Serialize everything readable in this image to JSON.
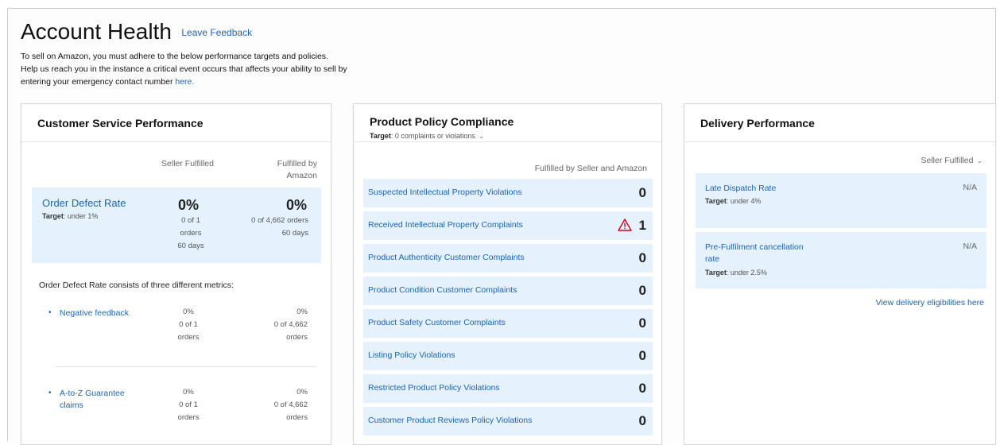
{
  "header": {
    "title": "Account Health",
    "feedback_link": "Leave Feedback",
    "intro_line1": "To sell on Amazon, you must adhere to the below performance targets and policies.",
    "intro_line2": "Help us reach you in the instance a critical event occurs that affects your ability to sell by",
    "intro_line3_prefix": "entering your emergency contact number ",
    "intro_link": "here."
  },
  "customer_service": {
    "title": "Customer Service Performance",
    "col_seller": "Seller Fulfilled",
    "col_fba_line1": "Fulfilled by",
    "col_fba_line2": "Amazon",
    "odr": {
      "name": "Order Defect Rate",
      "target_label": "Target",
      "target_value": ": under 1%",
      "seller_pct": "0%",
      "seller_line1": "0 of 1",
      "seller_line2": "orders",
      "seller_line3": "60 days",
      "fba_pct": "0%",
      "fba_line1": "0 of 4,662 orders",
      "fba_line2": "60 days"
    },
    "consists_text": "Order Defect Rate consists of three different metrics:",
    "metrics": [
      {
        "name_line1": "Negative feedback",
        "name_line2": "",
        "seller_pct": "0%",
        "seller_count": "0 of 1",
        "seller_unit": "orders",
        "fba_pct": "0%",
        "fba_count": "0 of 4,662",
        "fba_unit": "orders"
      },
      {
        "name_line1": "A-to-Z Guarantee",
        "name_line2": "claims",
        "seller_pct": "0%",
        "seller_count": "0 of 1",
        "seller_unit": "orders",
        "fba_pct": "0%",
        "fba_count": "0 of 4,662",
        "fba_unit": "orders"
      }
    ]
  },
  "product_policy": {
    "title": "Product Policy Compliance",
    "target_label": "Target",
    "target_value": ": 0 complaints or violations",
    "column_header": "Fulfilled by Seller and Amazon",
    "rows": [
      {
        "label": "Suspected Intellectual Property Violations",
        "value": "0",
        "warning": false
      },
      {
        "label": "Received Intellectual Property Complaints",
        "value": "1",
        "warning": true
      },
      {
        "label": "Product Authenticity Customer Complaints",
        "value": "0",
        "warning": false
      },
      {
        "label": "Product Condition Customer Complaints",
        "value": "0",
        "warning": false
      },
      {
        "label": "Product Safety Customer Complaints",
        "value": "0",
        "warning": false
      },
      {
        "label": "Listing Policy Violations",
        "value": "0",
        "warning": false
      },
      {
        "label": "Restricted Product Policy Violations",
        "value": "0",
        "warning": false
      },
      {
        "label": "Customer Product Reviews Policy Violations",
        "value": "0",
        "warning": false
      }
    ]
  },
  "delivery": {
    "title": "Delivery Performance",
    "column_header": "Seller Fulfilled",
    "rows": [
      {
        "name_line1": "Late Dispatch Rate",
        "name_line2": "",
        "target_label": "Target",
        "target_value": ": under 4%",
        "value": "N/A"
      },
      {
        "name_line1": "Pre-Fulfilment cancellation",
        "name_line2": "rate",
        "target_label": "Target",
        "target_value": ": under 2.5%",
        "value": "N/A"
      }
    ],
    "link": "View delivery eligibilities here"
  },
  "colors": {
    "link": "#1b64b6",
    "highlight_bg": "#e5f1fc",
    "warning": "#d0021b"
  }
}
